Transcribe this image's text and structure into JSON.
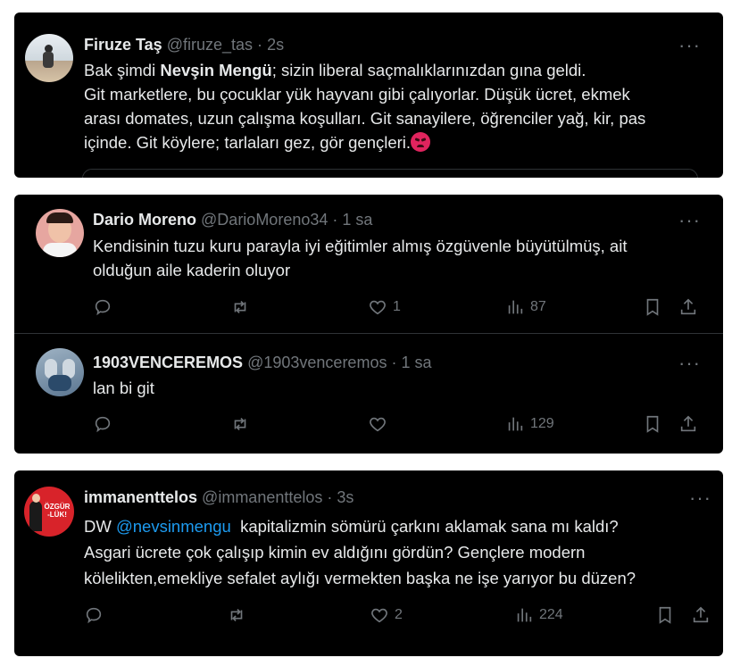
{
  "tweets": [
    {
      "name": "Firuze Taş",
      "handle": "@firuze_tas",
      "sep": "·",
      "time": "2s",
      "more": "···",
      "body_lines": {
        "l1_pre": "Bak şimdi ",
        "l1_bold": "Nevşin Mengü",
        "l1_post": "; sizin liberal saçmalıklarınızdan gına geldi.",
        "l2": "Git marketlere, bu çocuklar yük hayvanı gibi çalıyorlar. Düşük ücret, ekmek",
        "l3": "arası domates, uzun çalışma koşulları. Git sanayilere, öğrenciler yağ, kir, pas",
        "l4": "içinde. Git köylere; tarlaları gez, gör gençleri."
      },
      "emoji": "angry-face-emoji"
    },
    {
      "name": "Dario Moreno",
      "handle": "@DarioMoreno34",
      "sep": "·",
      "time": "1 sa",
      "more": "···",
      "body_lines": {
        "l1": "Kendisinin tuzu kuru parayla iyi eğitimler almış özgüvenle büyütülmüş, ait",
        "l2": "olduğun aile kaderin oluyor"
      },
      "likes": "1",
      "views": "87"
    },
    {
      "name": "1903VENCEREMOS",
      "handle": "@1903venceremos",
      "sep": "·",
      "time": "1 sa",
      "more": "···",
      "body_lines": {
        "l1": "lan bi git"
      },
      "likes": "",
      "views": "129"
    },
    {
      "name": "immanenttelos",
      "handle": "@immanenttelos",
      "sep": "·",
      "time": "3s",
      "more": "···",
      "body_lines": {
        "l1_pre": "DW ",
        "l1_mention": "@nevsinmengu",
        "l1_post": "  kapitalizmin sömürü çarkını aklamak sana mı kaldı?",
        "l2": "Asgari ücrete çok çalışıp kimin ev aldığını gördün? Gençlere modern",
        "l3": "kölelikten,emekliye sefalet aylığı vermekten başka ne işe yarıyor bu düzen?"
      },
      "likes": "2",
      "views": "224",
      "avatar_text": "ÖZGÜR-LÜK!"
    }
  ],
  "icons": {
    "reply": "reply-icon",
    "retweet": "retweet-icon",
    "like": "heart-icon",
    "views": "views-icon",
    "bookmark": "bookmark-icon",
    "share": "share-icon"
  },
  "colors": {
    "background": "#000000",
    "text": "#e7e9ea",
    "muted": "#71767b",
    "link": "#1d9bf0"
  }
}
